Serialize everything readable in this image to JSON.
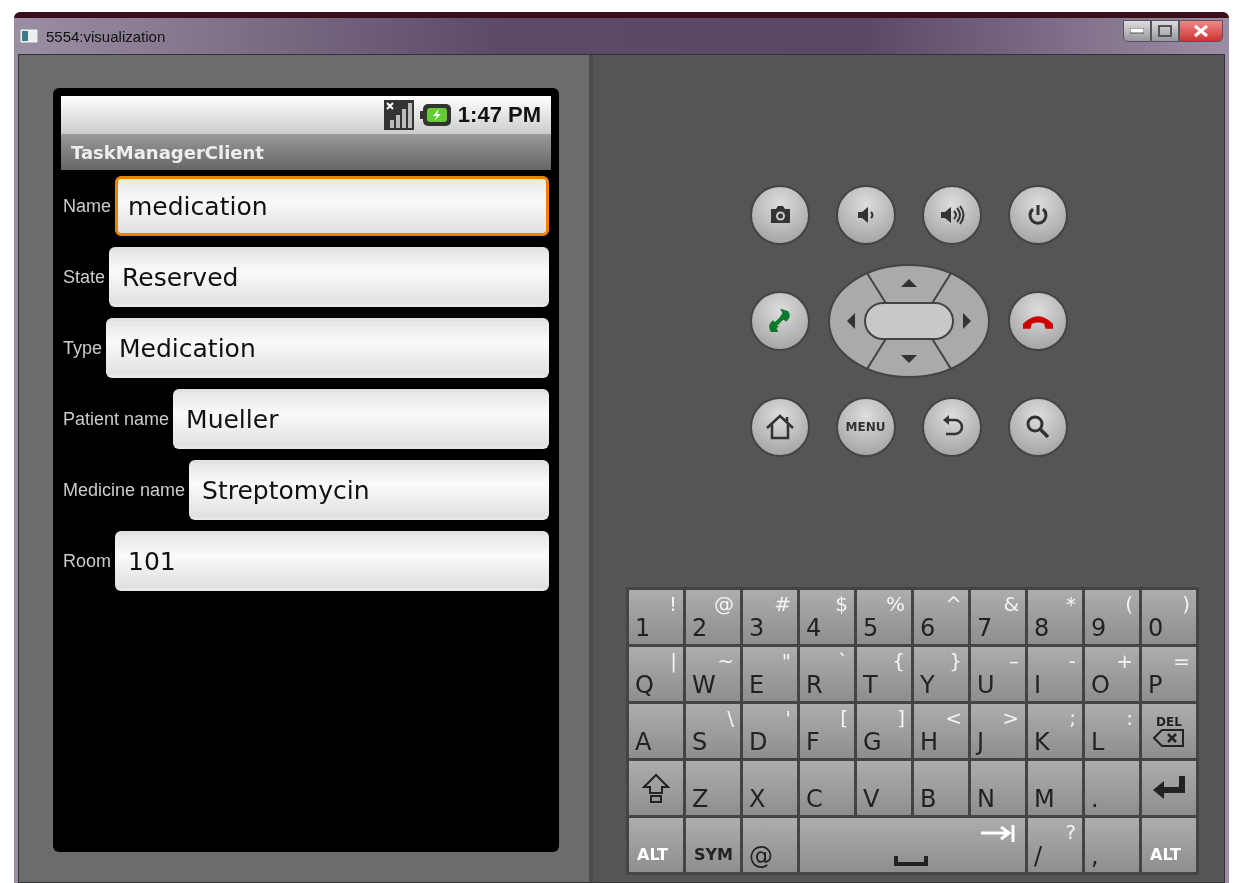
{
  "window": {
    "title": "5554:visualization"
  },
  "status_bar": {
    "time": "1:47 PM"
  },
  "app": {
    "title": "TaskManagerClient"
  },
  "form": [
    {
      "label": "Name",
      "value": "medication",
      "focused": true
    },
    {
      "label": "State",
      "value": "Reserved",
      "focused": false
    },
    {
      "label": "Type",
      "value": "Medication",
      "focused": false
    },
    {
      "label": "Patient name",
      "value": "Mueller",
      "focused": false
    },
    {
      "label": "Medicine name",
      "value": "Streptomycin",
      "focused": false
    },
    {
      "label": "Room",
      "value": "101",
      "focused": false
    }
  ],
  "hardware_buttons": {
    "menu_label": "MENU"
  },
  "keyboard": [
    [
      {
        "kind": "char",
        "main": "1",
        "alt": "!"
      },
      {
        "kind": "char",
        "main": "2",
        "alt": "@"
      },
      {
        "kind": "char",
        "main": "3",
        "alt": "#"
      },
      {
        "kind": "char",
        "main": "4",
        "alt": "$"
      },
      {
        "kind": "char",
        "main": "5",
        "alt": "%"
      },
      {
        "kind": "char",
        "main": "6",
        "alt": "^"
      },
      {
        "kind": "char",
        "main": "7",
        "alt": "&"
      },
      {
        "kind": "char",
        "main": "8",
        "alt": "*"
      },
      {
        "kind": "char",
        "main": "9",
        "alt": "("
      },
      {
        "kind": "char",
        "main": "0",
        "alt": ")"
      }
    ],
    [
      {
        "kind": "char",
        "main": "Q",
        "alt": "|"
      },
      {
        "kind": "char",
        "main": "W",
        "alt": "~"
      },
      {
        "kind": "char",
        "main": "E",
        "alt": "\""
      },
      {
        "kind": "char",
        "main": "R",
        "alt": "`"
      },
      {
        "kind": "char",
        "main": "T",
        "alt": "{"
      },
      {
        "kind": "char",
        "main": "Y",
        "alt": "}"
      },
      {
        "kind": "char",
        "main": "U",
        "alt": "–"
      },
      {
        "kind": "char",
        "main": "I",
        "alt": "-"
      },
      {
        "kind": "char",
        "main": "O",
        "alt": "+"
      },
      {
        "kind": "char",
        "main": "P",
        "alt": "="
      }
    ],
    [
      {
        "kind": "char",
        "main": "A"
      },
      {
        "kind": "char",
        "main": "S",
        "alt": "\\"
      },
      {
        "kind": "char",
        "main": "D",
        "alt": "'"
      },
      {
        "kind": "char",
        "main": "F",
        "alt": "["
      },
      {
        "kind": "char",
        "main": "G",
        "alt": "]"
      },
      {
        "kind": "char",
        "main": "H",
        "alt": "<"
      },
      {
        "kind": "char",
        "main": "J",
        "alt": ">"
      },
      {
        "kind": "char",
        "main": "K",
        "alt": ";"
      },
      {
        "kind": "char",
        "main": "L",
        "alt": ":"
      },
      {
        "kind": "delete",
        "main": "DEL"
      }
    ],
    [
      {
        "kind": "shift"
      },
      {
        "kind": "char",
        "main": "Z"
      },
      {
        "kind": "char",
        "main": "X"
      },
      {
        "kind": "char",
        "main": "C"
      },
      {
        "kind": "char",
        "main": "V"
      },
      {
        "kind": "char",
        "main": "B"
      },
      {
        "kind": "char",
        "main": "N"
      },
      {
        "kind": "char",
        "main": "M"
      },
      {
        "kind": "char",
        "main": "."
      },
      {
        "kind": "enter"
      }
    ],
    [
      {
        "kind": "label",
        "main": "ALT"
      },
      {
        "kind": "label",
        "main": "SYM"
      },
      {
        "kind": "char",
        "main": "@"
      },
      {
        "kind": "space"
      },
      {
        "kind": "char",
        "main": "/",
        "alt": "?"
      },
      {
        "kind": "char",
        "main": ","
      },
      {
        "kind": "label",
        "main": "ALT"
      }
    ]
  ]
}
